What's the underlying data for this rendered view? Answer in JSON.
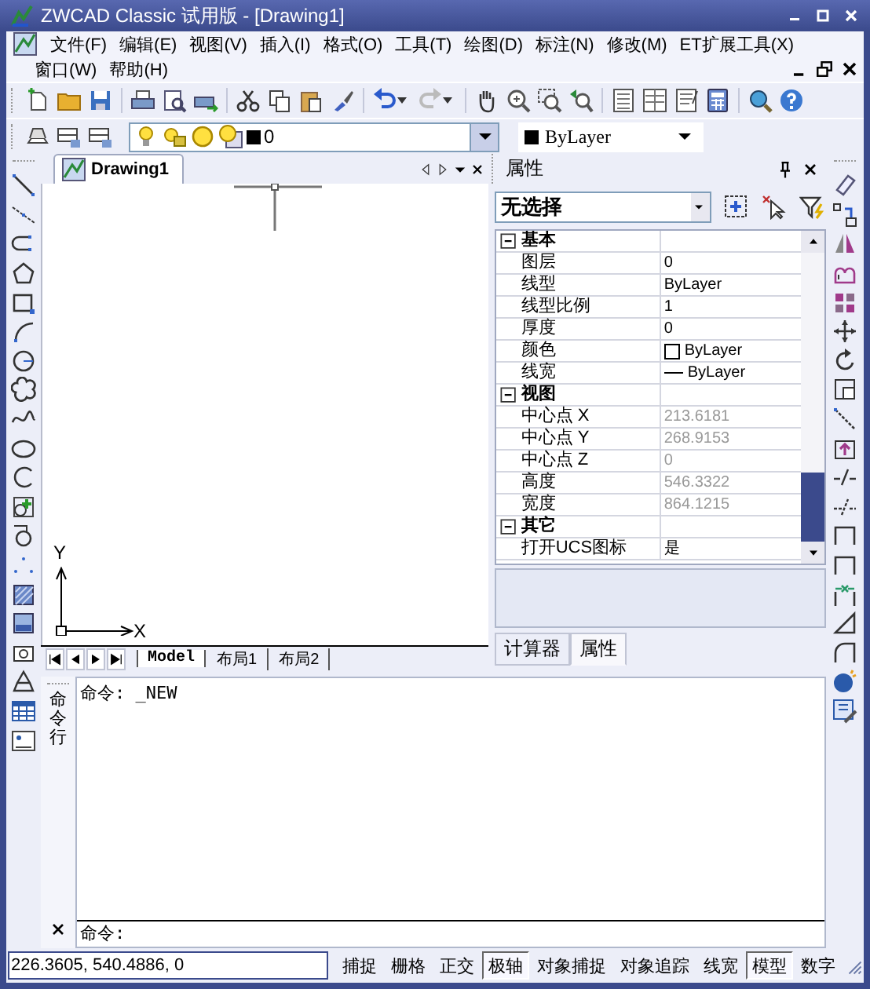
{
  "window": {
    "title": "ZWCAD Classic 试用版 - [Drawing1]"
  },
  "menu_rows": [
    [
      "文件(F)",
      "编辑(E)",
      "视图(V)",
      "插入(I)",
      "格式(O)",
      "工具(T)",
      "绘图(D)",
      "标注(N)",
      "修改(M)",
      "ET扩展工具(X)"
    ],
    [
      "窗口(W)",
      "帮助(H)"
    ]
  ],
  "layer_combo": {
    "value": "0"
  },
  "color_combo": {
    "value": "ByLayer"
  },
  "drawing": {
    "tab": "Drawing1",
    "axis_x": "X",
    "axis_y": "Y",
    "layout_tabs": [
      {
        "label": "Model",
        "selected": true
      },
      {
        "label": "布局1",
        "selected": false
      },
      {
        "label": "布局2",
        "selected": false
      }
    ]
  },
  "properties": {
    "title": "属性",
    "selection": "无选择",
    "sections": [
      {
        "name": "基本",
        "expanded": true,
        "rows": [
          {
            "label": "图层",
            "value": "0",
            "kind": "text",
            "readonly": false
          },
          {
            "label": "线型",
            "value": "ByLayer",
            "kind": "text",
            "readonly": false
          },
          {
            "label": "线型比例",
            "value": "1",
            "kind": "text",
            "readonly": false
          },
          {
            "label": "厚度",
            "value": "0",
            "kind": "text",
            "readonly": false
          },
          {
            "label": "颜色",
            "value": "ByLayer",
            "kind": "color",
            "readonly": false
          },
          {
            "label": "线宽",
            "value": "ByLayer",
            "kind": "lineweight",
            "readonly": false
          }
        ]
      },
      {
        "name": "视图",
        "expanded": true,
        "rows": [
          {
            "label": "中心点 X",
            "value": "213.6181",
            "kind": "text",
            "readonly": true
          },
          {
            "label": "中心点 Y",
            "value": "268.9153",
            "kind": "text",
            "readonly": true
          },
          {
            "label": "中心点 Z",
            "value": "0",
            "kind": "text",
            "readonly": true
          },
          {
            "label": "高度",
            "value": "546.3322",
            "kind": "text",
            "readonly": true
          },
          {
            "label": "宽度",
            "value": "864.1215",
            "kind": "text",
            "readonly": true
          }
        ]
      },
      {
        "name": "其它",
        "expanded": true,
        "rows": [
          {
            "label": "打开UCS图标",
            "value": "是",
            "kind": "text",
            "readonly": false
          }
        ]
      }
    ],
    "tabs": [
      {
        "label": "计算器",
        "selected": false
      },
      {
        "label": "属性",
        "selected": true
      }
    ]
  },
  "command": {
    "side_label": "命令行",
    "history": [
      "命令: _NEW"
    ],
    "prompt": "命令:"
  },
  "status_bar": {
    "coordinates": "226.3605, 540.4886, 0",
    "buttons": [
      {
        "label": "捕捉",
        "on": false
      },
      {
        "label": "栅格",
        "on": false
      },
      {
        "label": "正交",
        "on": false
      },
      {
        "label": "极轴",
        "on": true
      },
      {
        "label": "对象捕捉",
        "on": false
      },
      {
        "label": "对象追踪",
        "on": false
      },
      {
        "label": "线宽",
        "on": false
      },
      {
        "label": "模型",
        "on": true
      },
      {
        "label": "数字",
        "on": false
      }
    ]
  }
}
